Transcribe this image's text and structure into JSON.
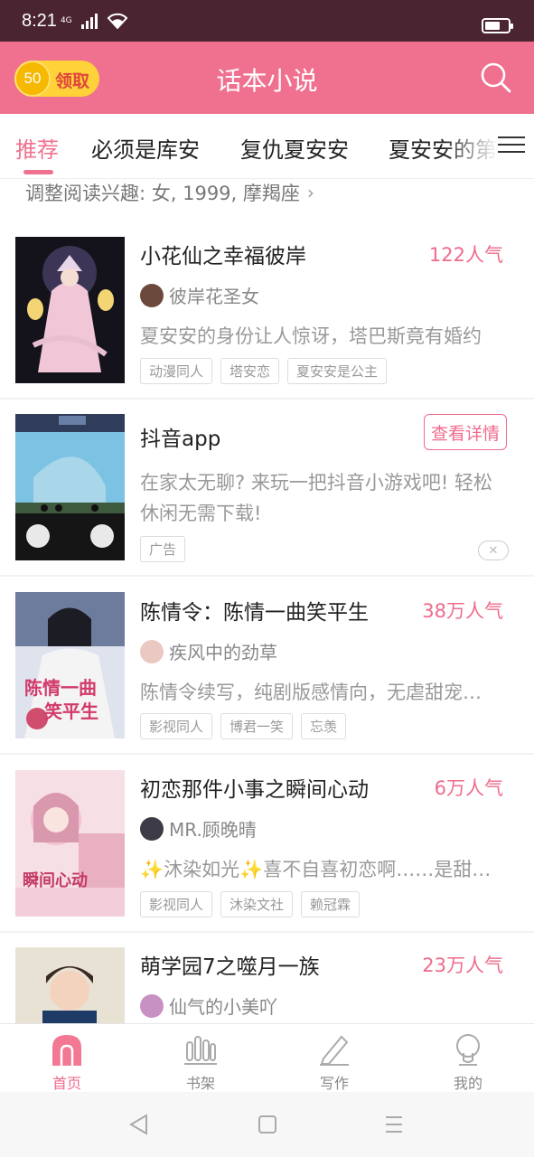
{
  "status_bar": {
    "time": "8:21",
    "network": "4G"
  },
  "header": {
    "coin_amount": "50",
    "coin_label": "领取",
    "title": "话本小说"
  },
  "tabs": [
    "推荐",
    "必须是库安",
    "复仇夏安安",
    "夏安安的第"
  ],
  "interest": {
    "text": "调整阅读兴趣: 女, 1999, 摩羯座"
  },
  "books": [
    {
      "title": "小花仙之幸福彼岸",
      "popularity": "122人气",
      "author": "彼岸花圣女",
      "desc": "夏安安的身份让人惊讶，塔巴斯竟有婚约",
      "tags": [
        "动漫同人",
        "塔安恋",
        "夏安安是公主"
      ]
    },
    {
      "title": "陈情令：陈情一曲笑平生",
      "popularity": "38万人气",
      "author": "疾风中的劲草",
      "desc": "陈情令续写，纯剧版感情向，无虐甜宠…",
      "tags": [
        "影视同人",
        "博君一笑",
        "忘羡"
      ]
    },
    {
      "title": "初恋那件小事之瞬间心动",
      "popularity": "6万人气",
      "author": "MR.顾晚晴",
      "desc": "✨沐染如光✨喜不自喜初恋啊……是甜…",
      "tags": [
        "影视同人",
        "沐染文社",
        "赖冠霖"
      ]
    },
    {
      "title": "萌学园7之噬月一族",
      "popularity": "23万人气",
      "author": "仙气的小美吖"
    }
  ],
  "ad": {
    "title": "抖音app",
    "detail_label": "查看详情",
    "desc_line1": "在家太无聊? 来玩一把抖音小游戏吧! 轻松",
    "desc_line2": "休闲无需下载!",
    "tag": "广告",
    "close": "✕"
  },
  "cover_text": {
    "cover2_a": "陈情一曲",
    "cover2_b": "笑平生",
    "cover3": "瞬间心动"
  },
  "bottom_nav": [
    {
      "label": "首页",
      "icon": "home-icon",
      "active": true
    },
    {
      "label": "书架",
      "icon": "bookshelf-icon",
      "active": false
    },
    {
      "label": "写作",
      "icon": "pen-icon",
      "active": false
    },
    {
      "label": "我的",
      "icon": "profile-icon",
      "active": false
    }
  ],
  "colors": {
    "accent": "#f0718f",
    "status_bar": "#4a2430",
    "coin": "#ffd23a"
  }
}
